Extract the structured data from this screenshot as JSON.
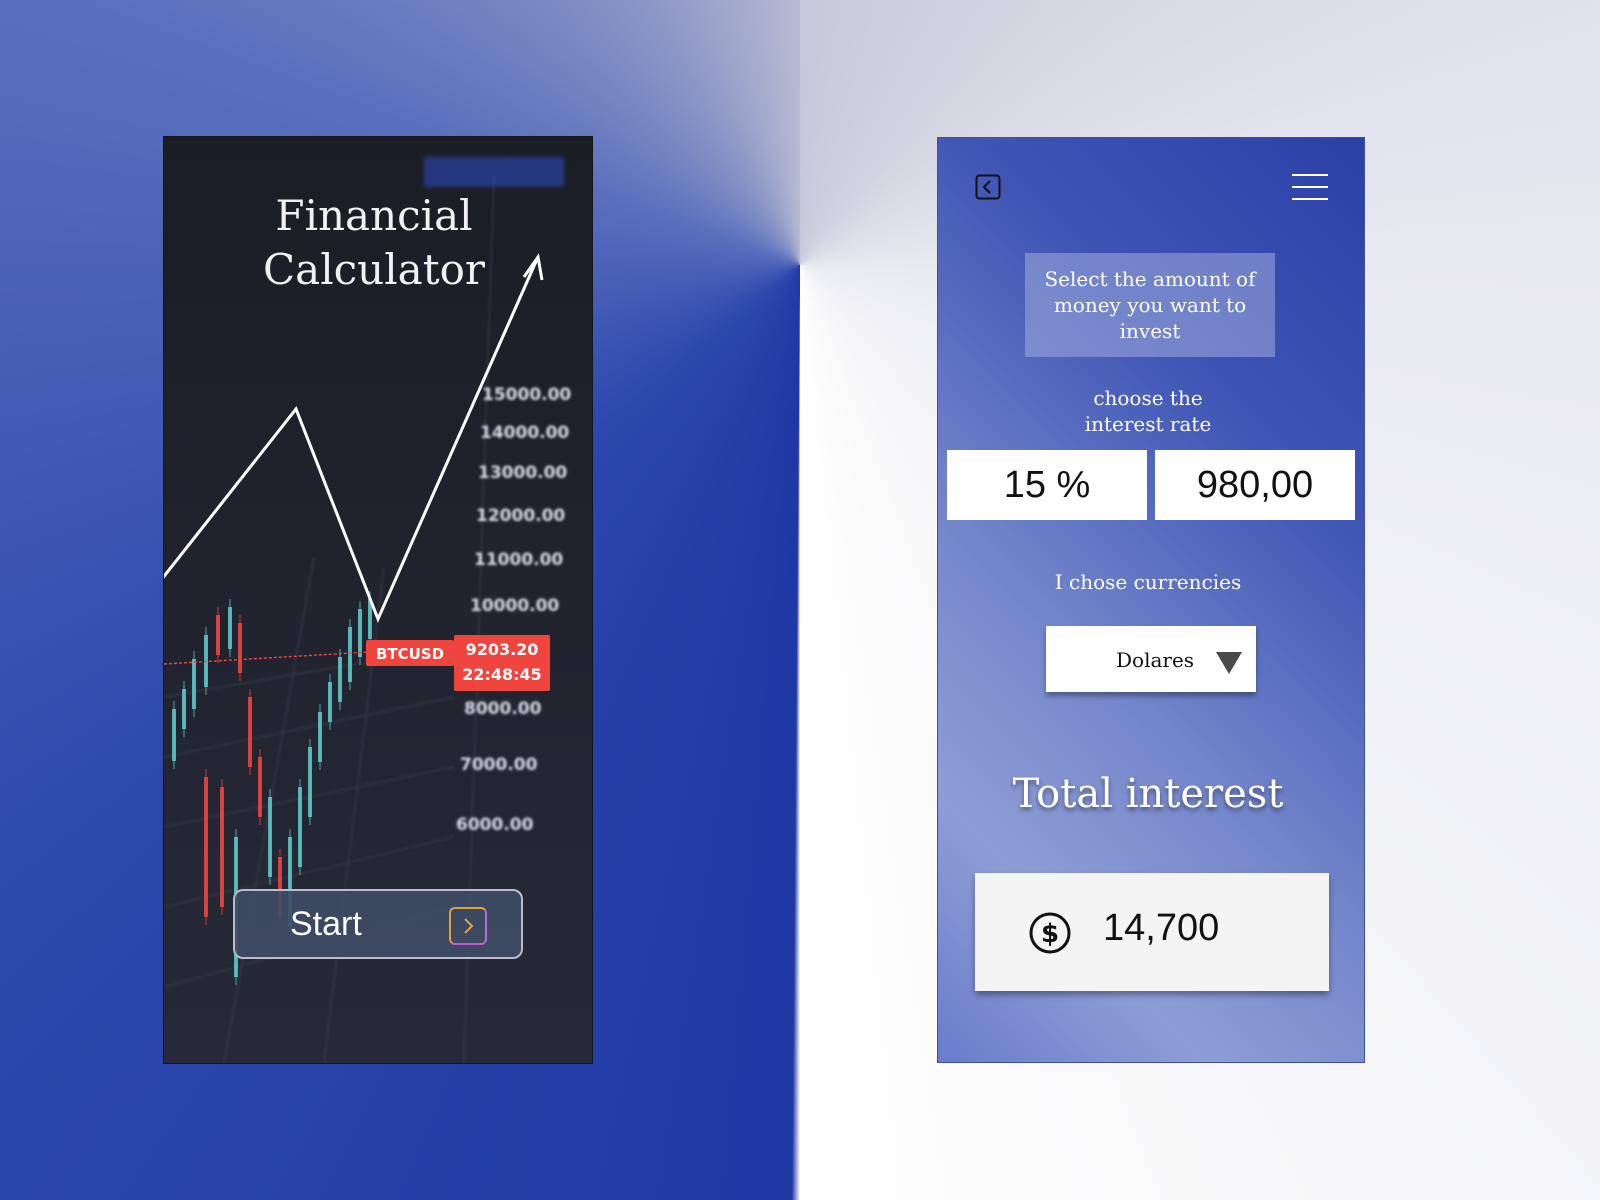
{
  "intro_screen": {
    "title_line1": "Financial",
    "title_line2": "Calculator",
    "start_label": "Start",
    "start_icon": "chevron-right-icon",
    "background_chart": {
      "symbol": "BTCUSD",
      "price": "9203.20",
      "time": "22:48:45",
      "price_ticks": [
        "15000.00",
        "14000.00",
        "13000.00",
        "12000.00",
        "11000.00",
        "10000.00",
        "8000.00",
        "7000.00",
        "6000.00"
      ]
    }
  },
  "calculator_screen": {
    "back_icon": "back-arrow-icon",
    "menu_icon": "hamburger-menu-icon",
    "amount_prompt": "Select the amount of money you want to invest",
    "rate_label_line1": "choose the",
    "rate_label_line2": "interest rate",
    "rate_value": "15 %",
    "amount_value": "980,00",
    "currency_label": "I chose currencies",
    "currency_selected": "Dolares",
    "total_heading": "Total interest",
    "total_value": "14,700",
    "total_icon": "dollar-circle-icon"
  },
  "colors": {
    "accent_blue": "#2a40a8",
    "candle_up": "#5fc9c9",
    "candle_down": "#f0453f",
    "price_tag": "#f0453f"
  }
}
